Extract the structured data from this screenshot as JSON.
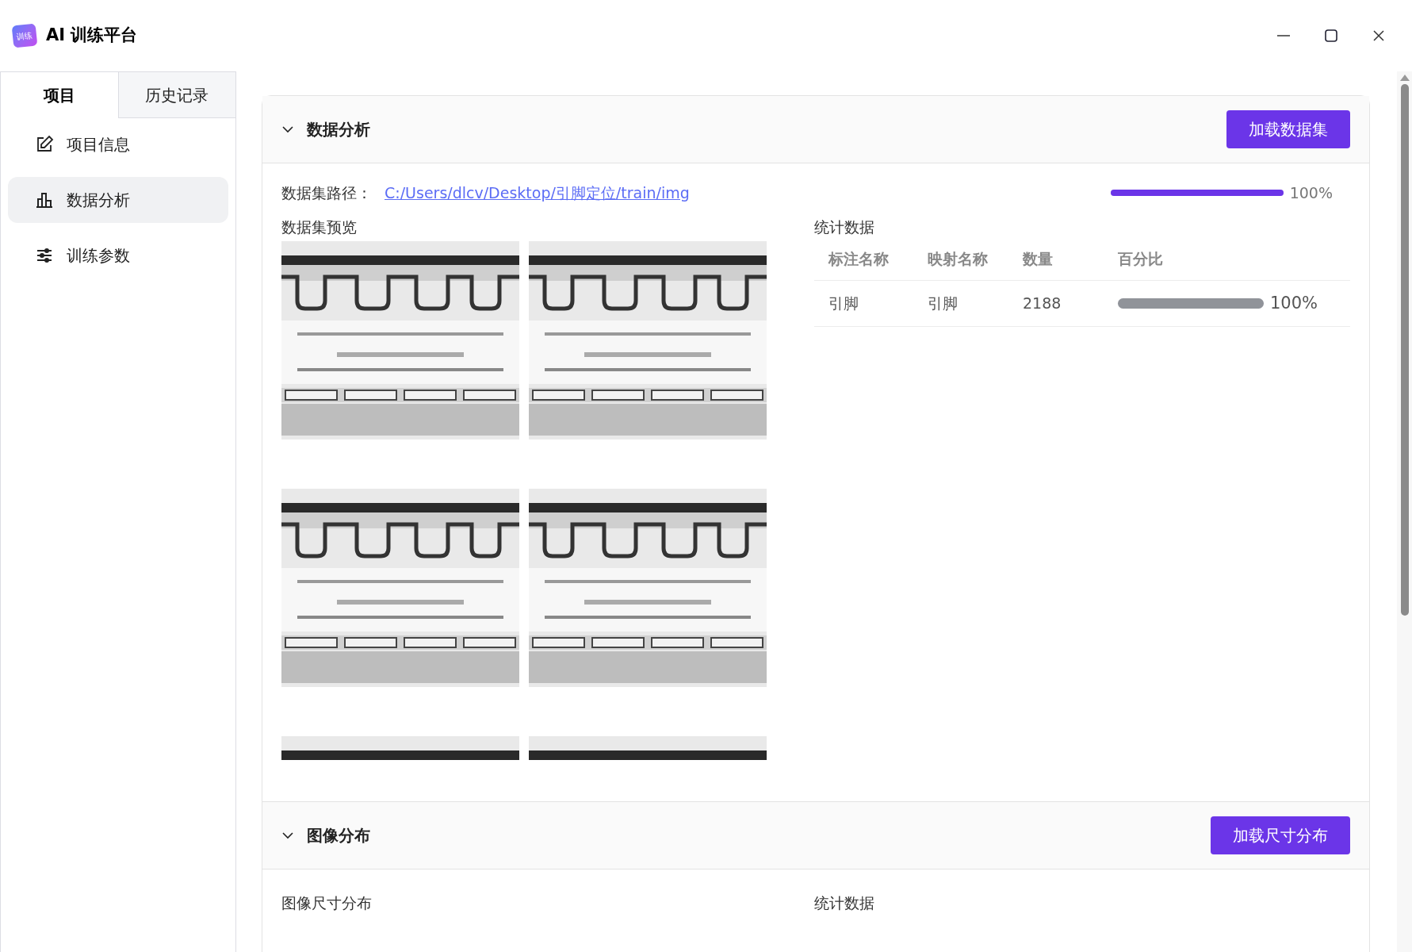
{
  "window": {
    "title": "AI 训练平台",
    "logo_text": "训练"
  },
  "sidebar": {
    "tabs": [
      {
        "label": "项目",
        "selected": true
      },
      {
        "label": "历史记录",
        "selected": false
      }
    ],
    "items": [
      {
        "label": "项目信息",
        "selected": false
      },
      {
        "label": "数据分析",
        "selected": true
      },
      {
        "label": "训练参数",
        "selected": false
      }
    ]
  },
  "sections": [
    {
      "title": "数据分析",
      "expanded": true,
      "button": "加载数据集"
    },
    {
      "title": "图像分布",
      "expanded": true,
      "button": "加载尺寸分布"
    }
  ],
  "dataset": {
    "path_label": "数据集路径：",
    "path": "C:/Users/dlcv/Desktop/引脚定位/train/img",
    "progress": {
      "level": 1,
      "reading": "100%"
    },
    "preview_label": "数据集预览"
  },
  "stats": {
    "title": "统计数据",
    "columns": [
      "标注名称",
      "映射名称",
      "数量",
      "百分比"
    ],
    "rows": [
      {
        "name": "引脚",
        "mapped": "引脚",
        "count": "2188",
        "level": 1,
        "reading": "100%"
      }
    ]
  },
  "distribution": {
    "left_label": "图像尺寸分布",
    "right_label": "统计数据"
  }
}
